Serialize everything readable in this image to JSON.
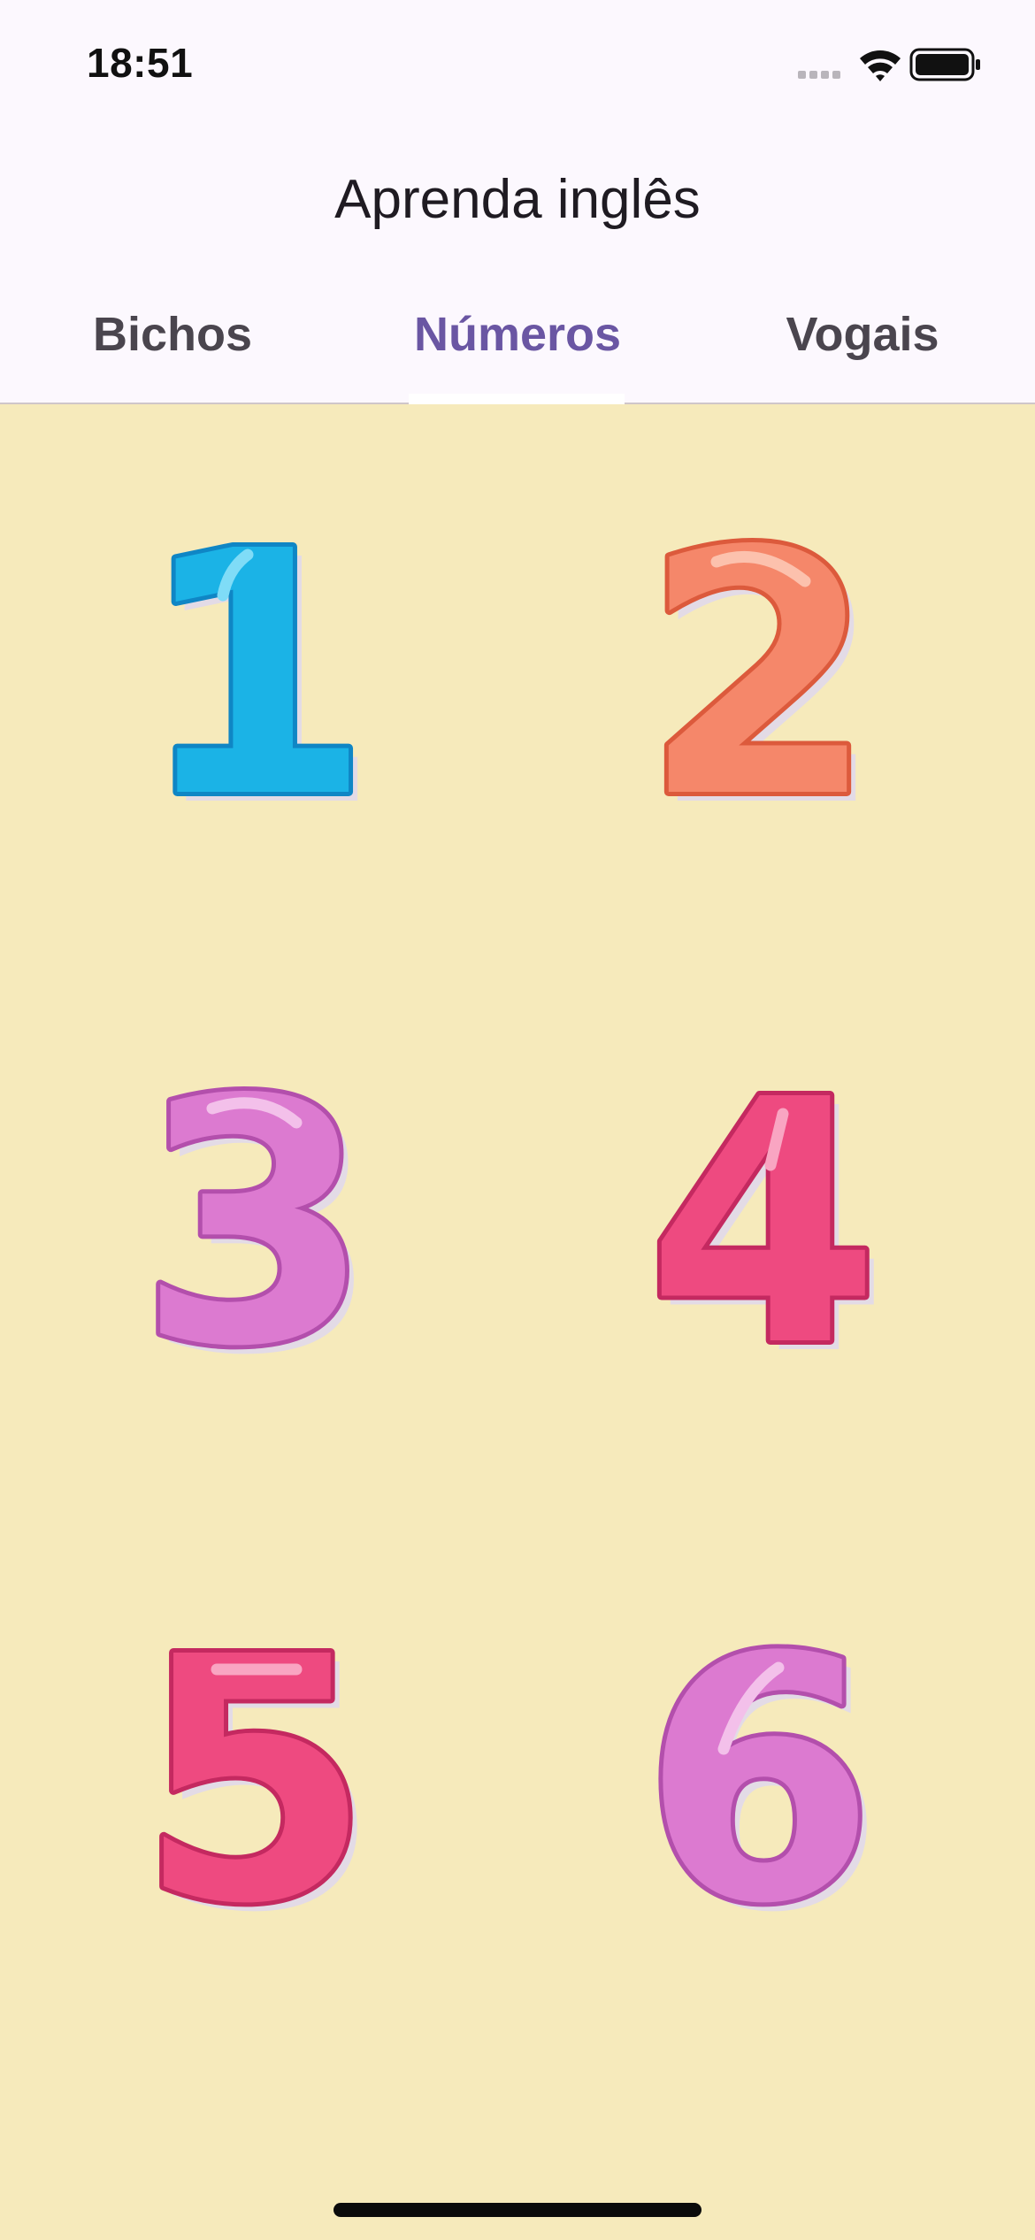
{
  "status_bar": {
    "time": "18:51",
    "icons": [
      "cellular-signal-icon",
      "wifi-icon",
      "battery-icon"
    ]
  },
  "header": {
    "title": "Aprenda inglês"
  },
  "tabs": [
    {
      "label": "Bichos",
      "active": false
    },
    {
      "label": "Números",
      "active": true
    },
    {
      "label": "Vogais",
      "active": false
    }
  ],
  "colors": {
    "header_background": "#fcf8fe",
    "content_background": "#f6eabb",
    "active_tab": "#6a56a3",
    "inactive_tab": "#4a454e"
  },
  "numbers": [
    {
      "digit": "1",
      "fill": "#1bb3e6",
      "stroke": "#0f86c5",
      "highlight": "#7fdcf7"
    },
    {
      "digit": "2",
      "fill": "#f5876a",
      "stroke": "#dc5a3c",
      "highlight": "#fcc1ad"
    },
    {
      "digit": "3",
      "fill": "#dc7ad0",
      "stroke": "#b34fac",
      "highlight": "#f3c0ea"
    },
    {
      "digit": "4",
      "fill": "#ee4a80",
      "stroke": "#c42960",
      "highlight": "#f9a5c2"
    },
    {
      "digit": "5",
      "fill": "#ee4a80",
      "stroke": "#c42960",
      "highlight": "#f9a5c2"
    },
    {
      "digit": "6",
      "fill": "#dc7ad0",
      "stroke": "#b34fac",
      "highlight": "#f3c0ea"
    }
  ]
}
